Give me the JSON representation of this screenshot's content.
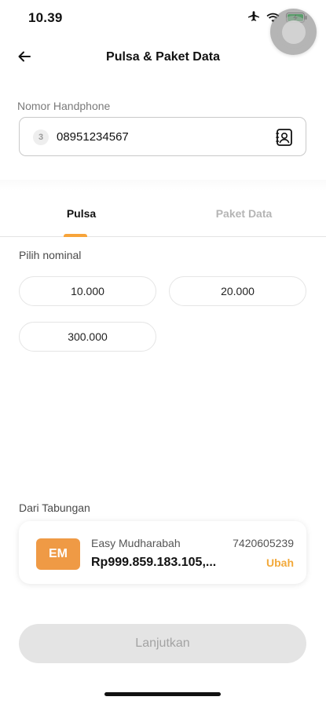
{
  "status_bar": {
    "time": "10.39",
    "icons": [
      "airplane-icon",
      "wifi-icon",
      "battery-charging-icon"
    ],
    "battery_color": "#34c759"
  },
  "header": {
    "title": "Pulsa & Paket Data",
    "back_icon": "arrow-left-icon"
  },
  "phone": {
    "label": "Nomor Handphone",
    "operator_logo_text": "3",
    "value": "08951234567",
    "contact_icon": "contact-book-icon"
  },
  "tabs": [
    {
      "label": "Pulsa",
      "active": true
    },
    {
      "label": "Paket Data",
      "active": false
    }
  ],
  "nominal": {
    "label": "Pilih nominal",
    "options": [
      "10.000",
      "20.000",
      "300.000"
    ]
  },
  "source": {
    "label": "Dari Tabungan",
    "badge": "EM",
    "account_name": "Easy Mudharabah",
    "account_number": "7420605239",
    "balance": "Rp999.859.183.105,...",
    "change_label": "Ubah"
  },
  "continue_label": "Lanjutkan",
  "colors": {
    "accent": "#f7a43a",
    "badge": "#ef9a45",
    "disabled_button": "#e4e4e4"
  }
}
